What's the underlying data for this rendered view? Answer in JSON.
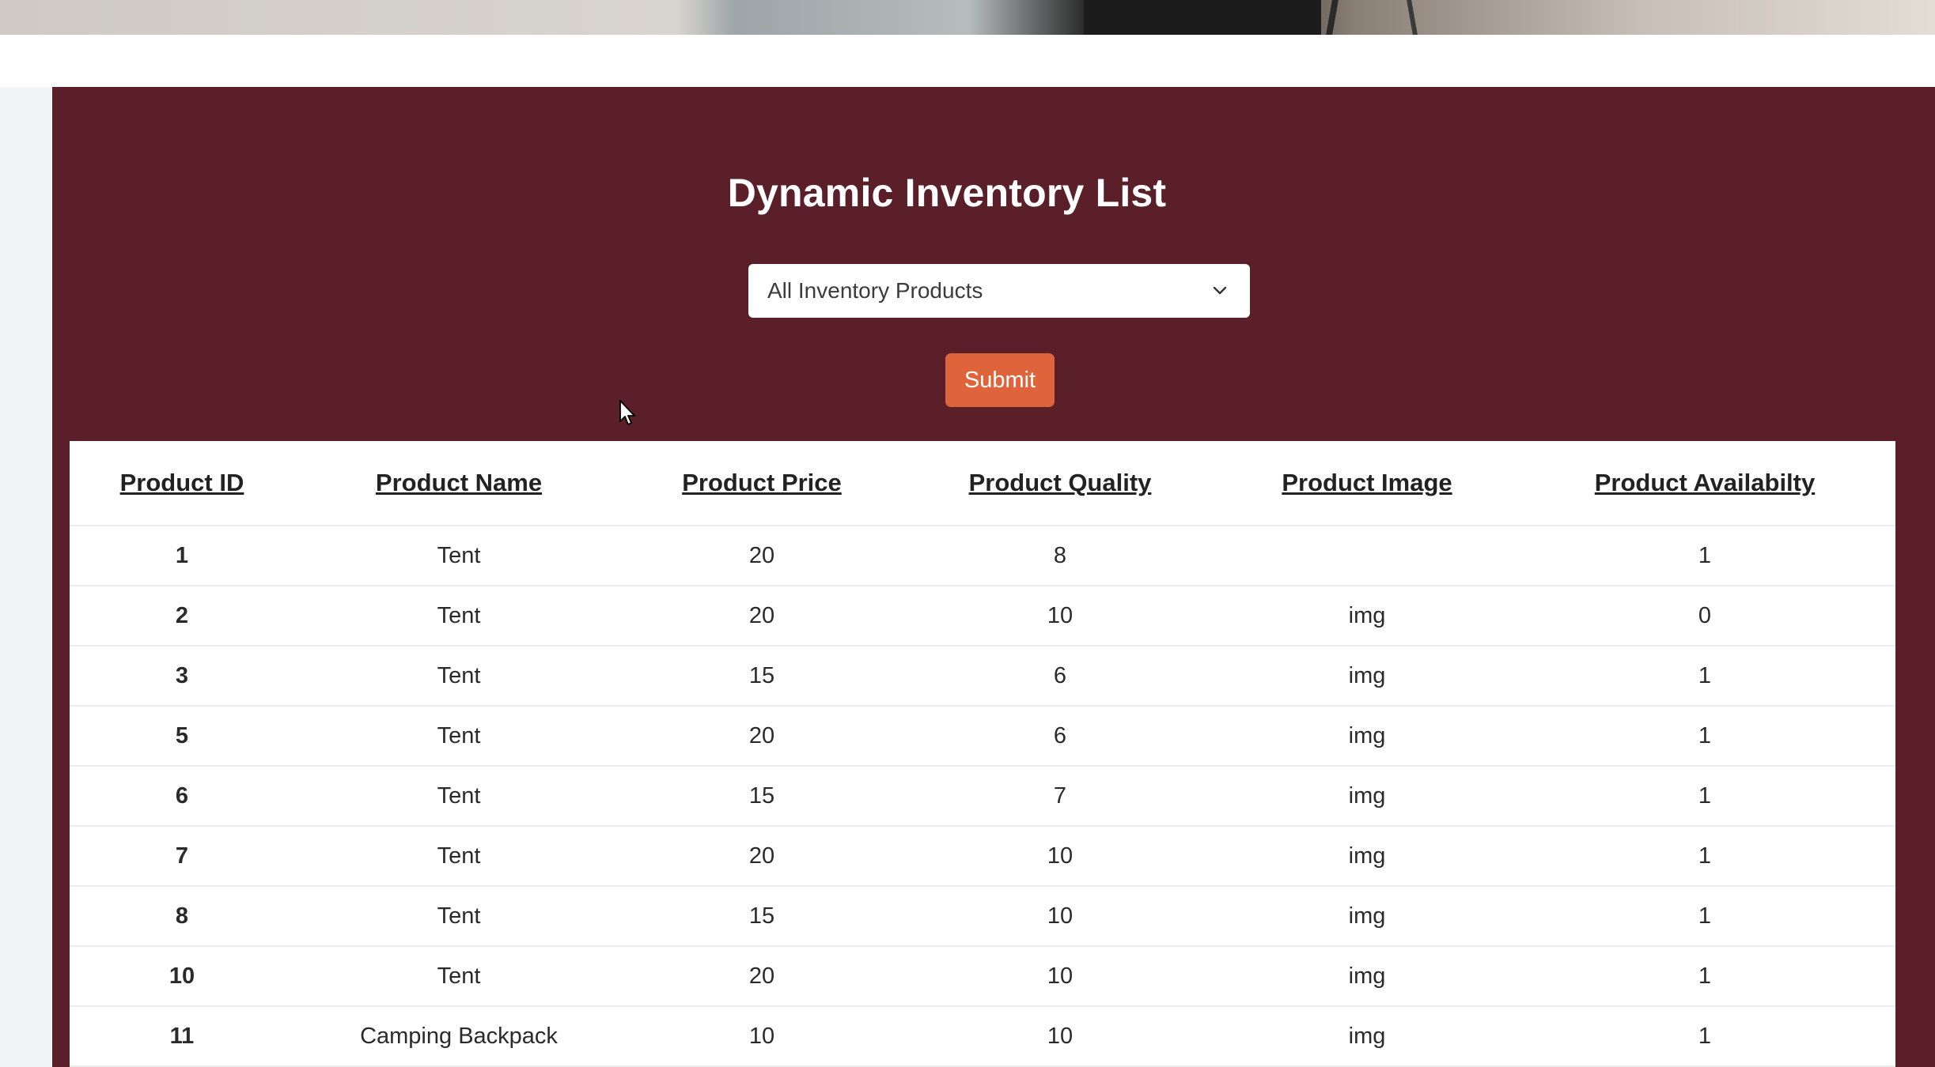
{
  "title": "Dynamic Inventory List",
  "filter": {
    "selected": "All Inventory Products"
  },
  "submit_label": "Submit",
  "table": {
    "headers": [
      "Product ID",
      "Product Name",
      "Product Price",
      "Product Quality",
      "Product Image",
      "Product Availabilty"
    ],
    "rows": [
      [
        "1",
        "Tent",
        "20",
        "8",
        "",
        "1"
      ],
      [
        "2",
        "Tent",
        "20",
        "10",
        "img",
        "0"
      ],
      [
        "3",
        "Tent",
        "15",
        "6",
        "img",
        "1"
      ],
      [
        "5",
        "Tent",
        "20",
        "6",
        "img",
        "1"
      ],
      [
        "6",
        "Tent",
        "15",
        "7",
        "img",
        "1"
      ],
      [
        "7",
        "Tent",
        "20",
        "10",
        "img",
        "1"
      ],
      [
        "8",
        "Tent",
        "15",
        "10",
        "img",
        "1"
      ],
      [
        "10",
        "Tent",
        "20",
        "10",
        "img",
        "1"
      ],
      [
        "11",
        "Camping Backpack",
        "10",
        "10",
        "img",
        "1"
      ]
    ]
  },
  "colors": {
    "panel": "#5a1f29",
    "submit": "#e0643b"
  }
}
